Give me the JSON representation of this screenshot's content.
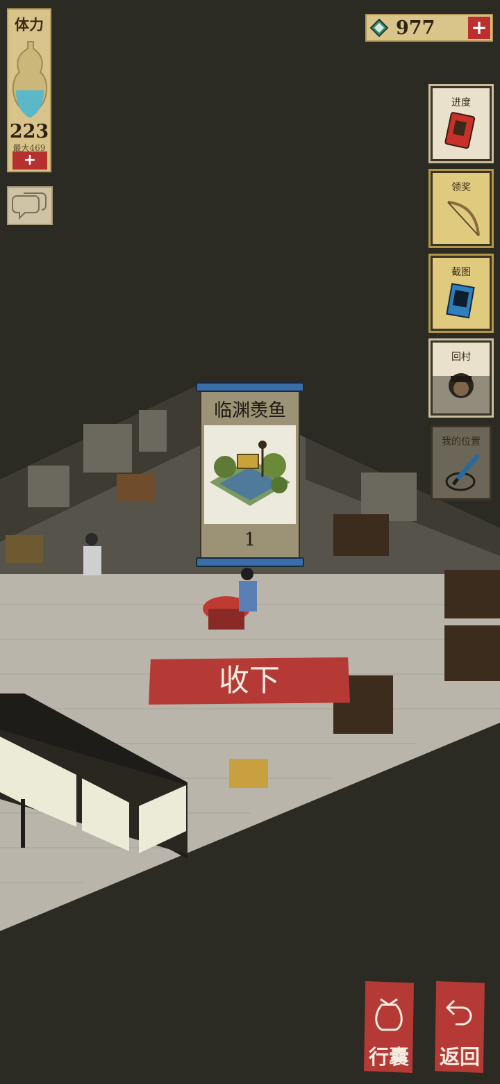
{
  "hud": {
    "stamina": {
      "title": "体力",
      "value": "223",
      "max_label": "最大469",
      "add": "+"
    },
    "currency": {
      "amount": "977",
      "add": "+"
    }
  },
  "side_buttons": [
    {
      "label": "进度",
      "icon": "book-icon"
    },
    {
      "label": "领奖",
      "icon": "bow-icon"
    },
    {
      "label": "截图",
      "icon": "photo-icon"
    },
    {
      "label": "回村",
      "icon": "character-portrait-icon"
    },
    {
      "label": "我的位置",
      "icon": "brush-location-icon"
    }
  ],
  "reward_card": {
    "name": "临渊羡鱼",
    "quantity": "1"
  },
  "accept_button": {
    "label": "收下"
  },
  "bottom_buttons": [
    {
      "label": "行囊",
      "icon": "bag-icon"
    },
    {
      "label": "返回",
      "icon": "return-arrow-icon"
    }
  ],
  "colors": {
    "background": "#2b2a23",
    "accent_red": "#b53a36",
    "panel_gold": "#d8c48a",
    "card_blue": "#3a6ea8"
  }
}
